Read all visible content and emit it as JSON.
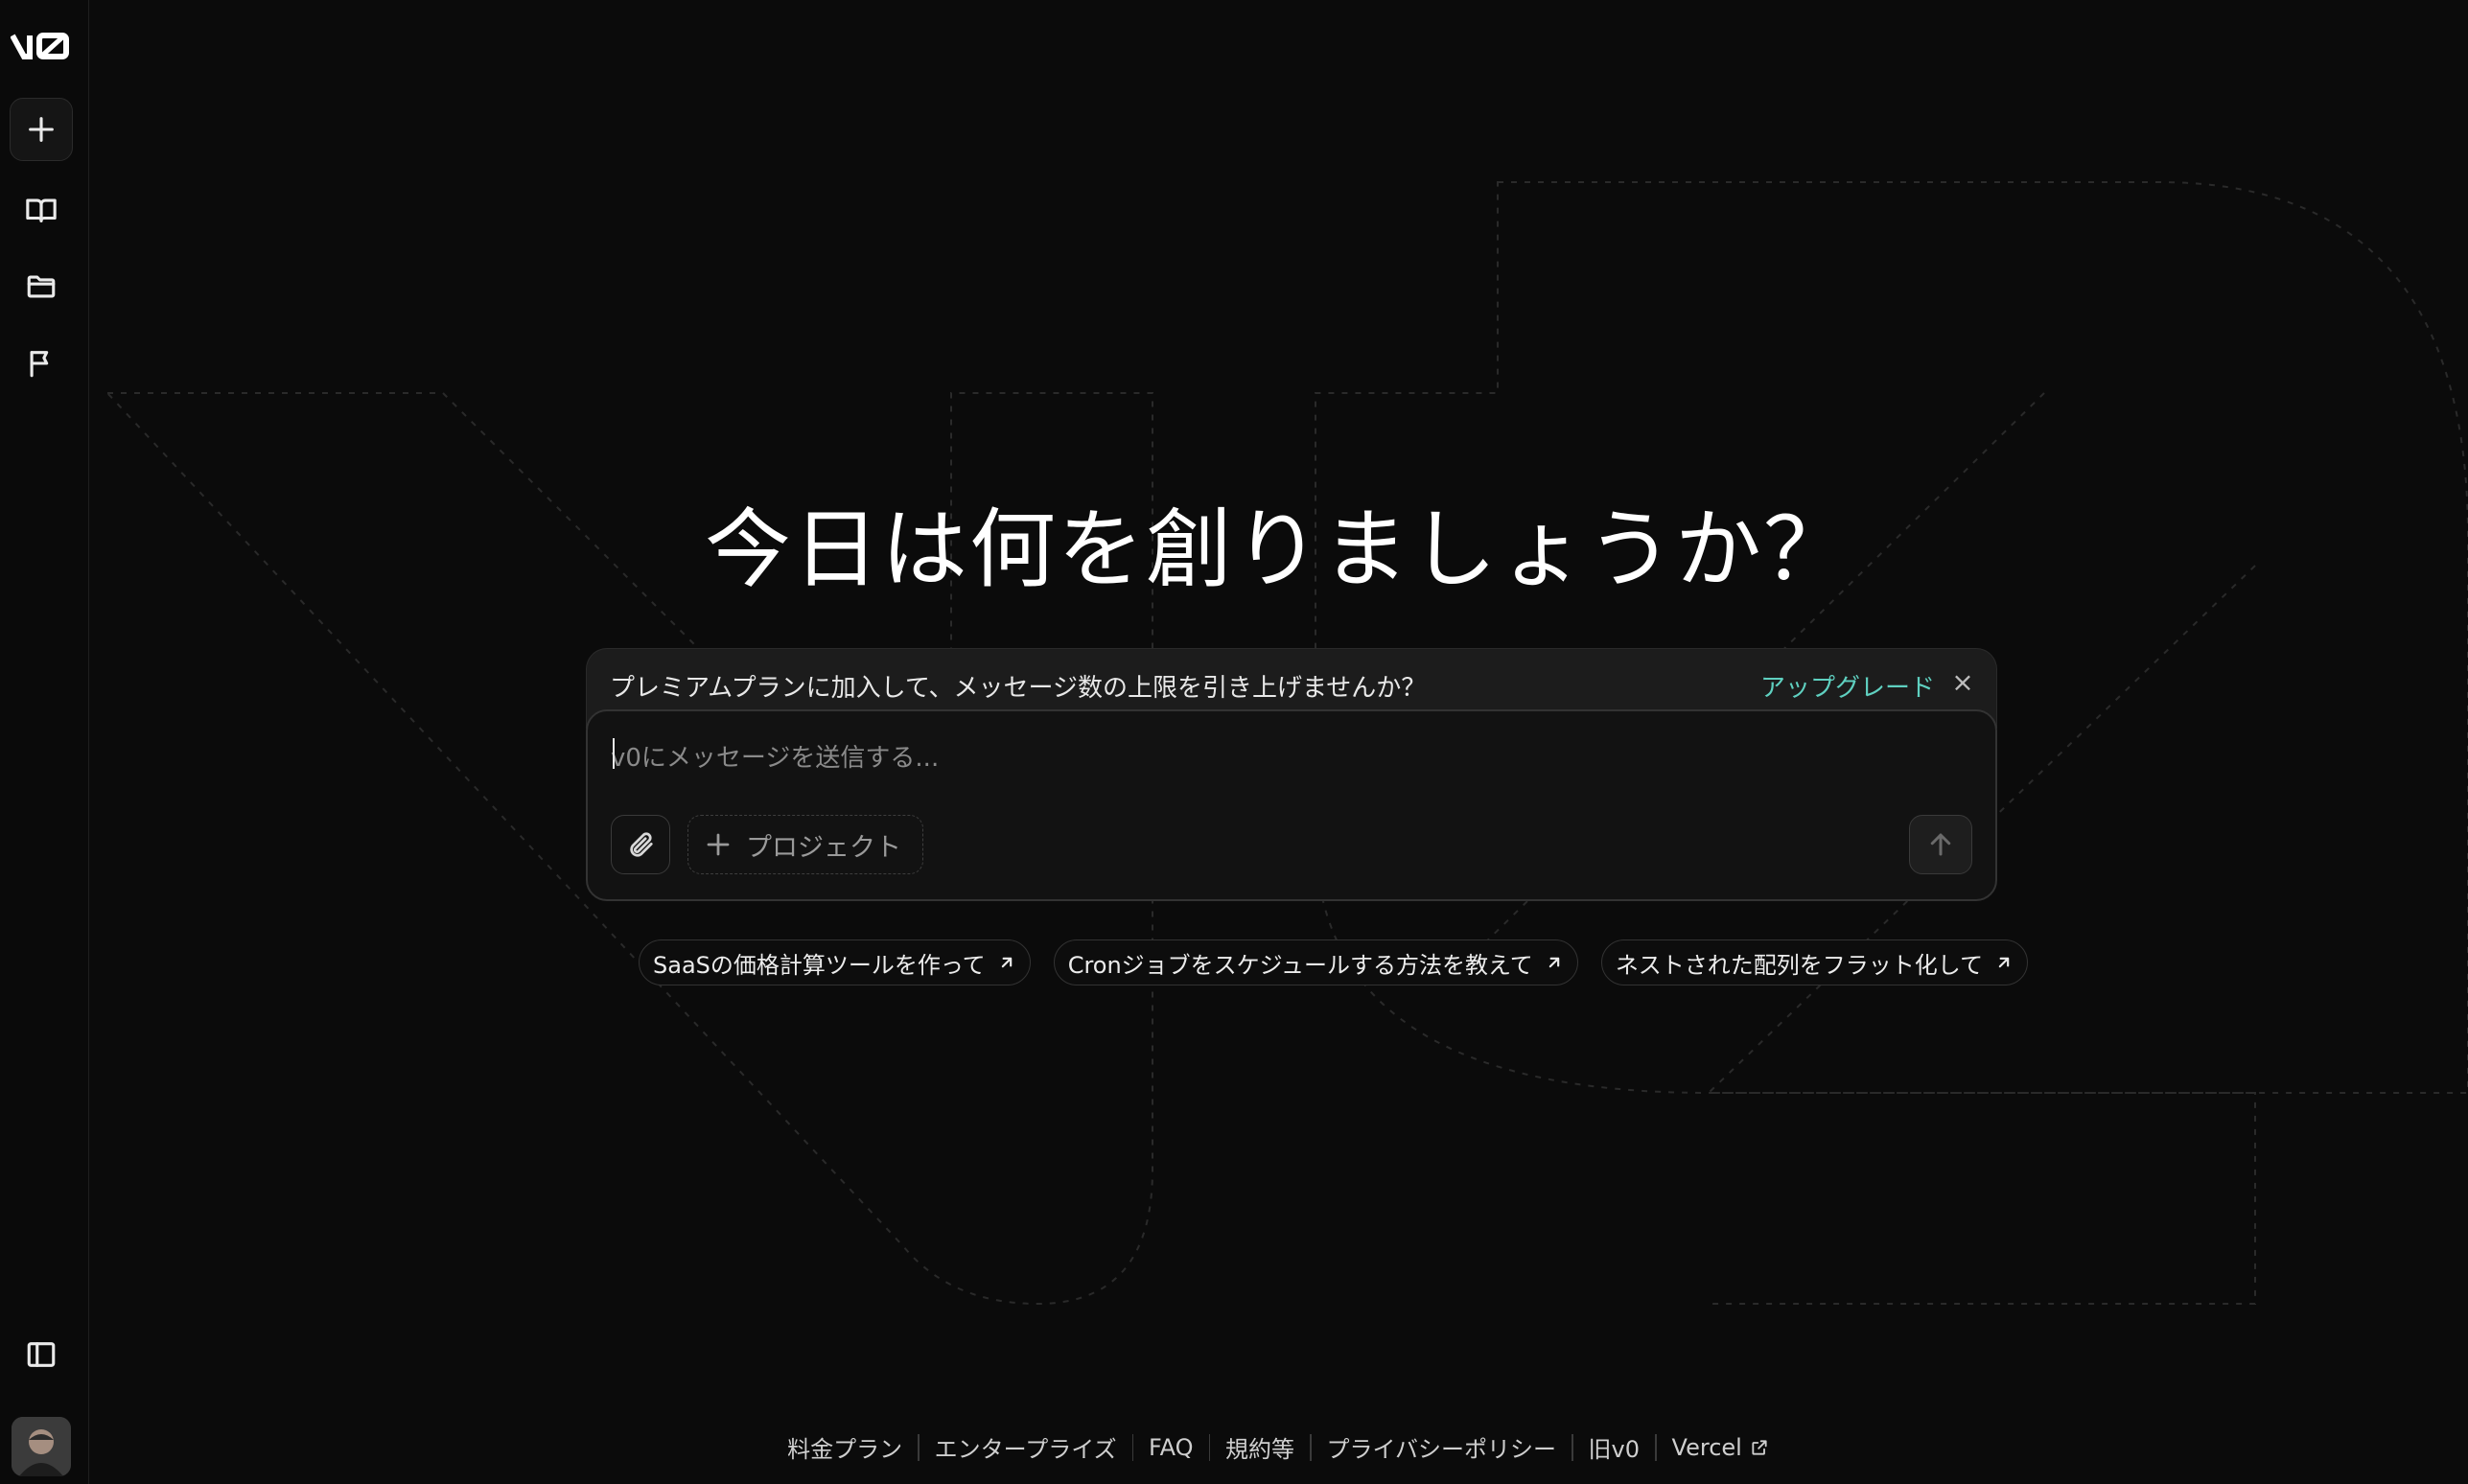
{
  "sidebar": {
    "logo": "v0",
    "icons": [
      "plus-icon",
      "book-icon",
      "folder-icon",
      "flag-icon",
      "sidebar-toggle-icon"
    ]
  },
  "main": {
    "headline": "今日は何を創りましょうか？"
  },
  "banner": {
    "text": "プレミアムプランに加入して、メッセージ数の上限を引き上げませんか？",
    "upgrade_label": "アップグレード",
    "close_label": "×"
  },
  "composer": {
    "placeholder": "v0にメッセージを送信する...",
    "project_label": "プロジェクト"
  },
  "suggestions": [
    {
      "label": "SaaSの価格計算ツールを作って"
    },
    {
      "label": "Cronジョブをスケジュールする方法を教えて"
    },
    {
      "label": "ネストされた配列をフラット化して"
    }
  ],
  "footer": {
    "links": [
      "料金プラン",
      "エンタープライズ",
      "FAQ",
      "規約等",
      "プライバシーポリシー",
      "旧v0",
      "Vercel"
    ]
  },
  "colors": {
    "background": "#0b0b0b",
    "accent": "#5fd0c0",
    "surface": "#1c1c1c"
  }
}
